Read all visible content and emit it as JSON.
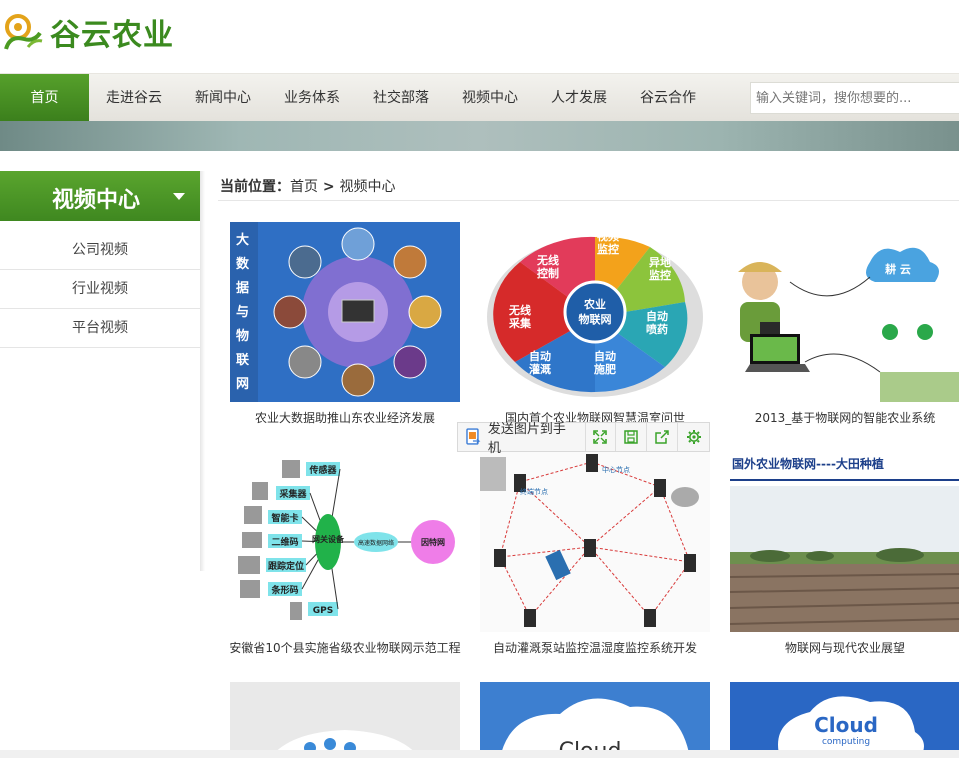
{
  "header": {
    "logo_text": "谷云农业"
  },
  "nav": {
    "items": [
      {
        "label": "首页",
        "active": true
      },
      {
        "label": "走进谷云"
      },
      {
        "label": "新闻中心"
      },
      {
        "label": "业务体系"
      },
      {
        "label": "社交部落"
      },
      {
        "label": "视频中心"
      },
      {
        "label": "人才发展"
      },
      {
        "label": "谷云合作"
      }
    ],
    "search_placeholder": "输入关键词，搜你想要的..."
  },
  "sidebar": {
    "title": "视频中心",
    "items": [
      {
        "label": "公司视频"
      },
      {
        "label": "行业视频"
      },
      {
        "label": "平台视频"
      }
    ]
  },
  "breadcrumb": {
    "prefix": "当前位置：",
    "home": "首页",
    "sep": " > ",
    "current": "视频中心"
  },
  "videos": [
    {
      "caption": "农业大数据助推山东农业经济发展",
      "thumb_text": [
        "大",
        "数",
        "据",
        "与",
        "物",
        "联",
        "网"
      ]
    },
    {
      "caption": "国内首个农业物联网智慧温室问世",
      "thumb_text": [
        "农业",
        "物联网",
        "视频",
        "监控",
        "无线",
        "控制",
        "异地",
        "监控",
        "无线",
        "采集",
        "自动",
        "喷药",
        "自动",
        "灌溉",
        "自动",
        "施肥"
      ]
    },
    {
      "caption": "2013_基于物联网的智能农业系统",
      "thumb_text": [
        "耕 云"
      ]
    },
    {
      "caption": "安徽省10个县实施省级农业物联网示范工程",
      "thumb_text": [
        "传感器",
        "采集器",
        "智能卡",
        "二维码",
        "跟踪定位",
        "条形码",
        "GPS",
        "网关设备",
        "高速数据网络",
        "因特网"
      ]
    },
    {
      "caption": "自动灌溉泵站监控温湿度监控系统开发",
      "thumb_text": [
        "中心节点",
        "终端节点"
      ]
    },
    {
      "caption": "物联网与现代农业展望",
      "thumb_text": [
        "国外农业物联网----大田种植"
      ]
    },
    {
      "caption": "",
      "thumb_text": []
    },
    {
      "caption": "",
      "thumb_text": [
        "Cloud"
      ]
    },
    {
      "caption": "",
      "thumb_text": [
        "Cloud",
        "computing"
      ]
    }
  ],
  "toolbar": {
    "send_label": "发送图片到手机"
  },
  "colors": {
    "brand_green": "#3b8a1f",
    "nav_active": "#4a9526",
    "search_text": "#4a9a1f"
  }
}
